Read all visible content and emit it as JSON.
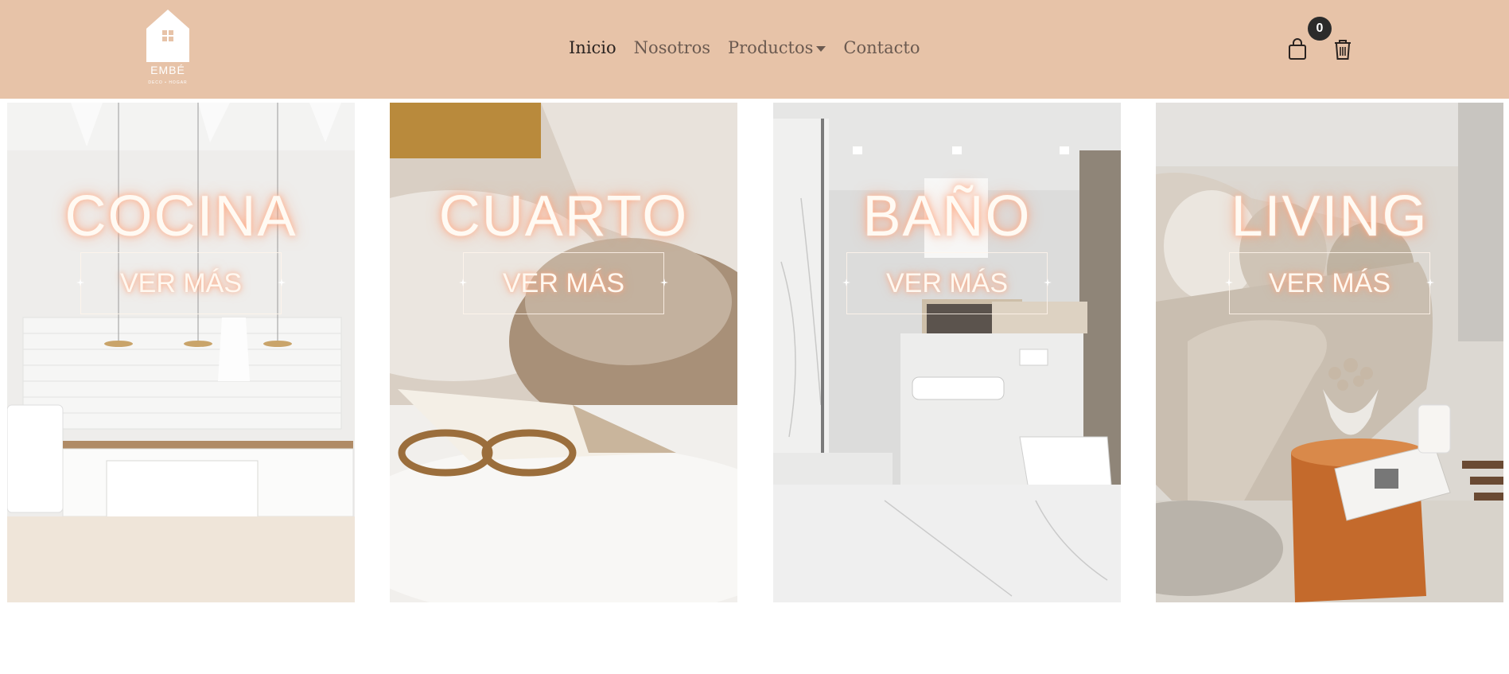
{
  "brand": {
    "name": "EMBÉ",
    "tagline": "DECO • HOGAR"
  },
  "nav": {
    "items": [
      {
        "label": "Inicio",
        "active": true
      },
      {
        "label": "Nosotros",
        "active": false
      },
      {
        "label": "Productos",
        "active": false,
        "dropdown": true
      },
      {
        "label": "Contacto",
        "active": false
      }
    ]
  },
  "cart": {
    "count": "0",
    "icon": "shopping-bag-icon"
  },
  "trash": {
    "icon": "trash-icon"
  },
  "categories": [
    {
      "title": "COCINA",
      "button": "VER MÁS"
    },
    {
      "title": "CUARTO",
      "button": "VER MÁS"
    },
    {
      "title": "BAÑO",
      "button": "VER MÁS"
    },
    {
      "title": "LIVING",
      "button": "VER MÁS"
    }
  ],
  "colors": {
    "navbar": "#e7c3a8",
    "badge": "#2b2b2b",
    "text_dark": "#2a2320",
    "text_muted": "#6b5a50"
  }
}
